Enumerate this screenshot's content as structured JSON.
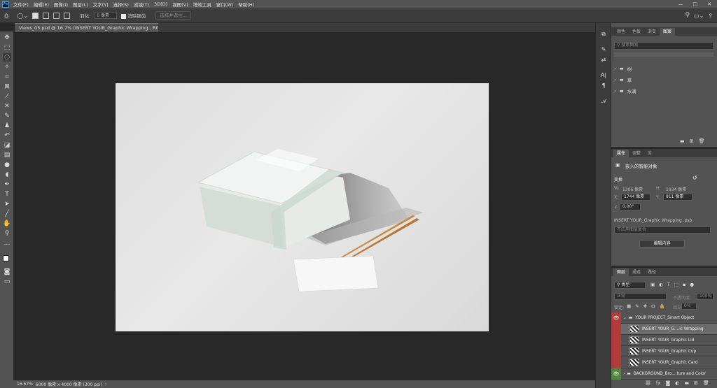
{
  "app": {
    "logo": "Ps"
  },
  "menu": [
    "文件(F)",
    "编辑(E)",
    "图像(I)",
    "图层(L)",
    "文字(Y)",
    "选择(S)",
    "滤镜(T)",
    "3D(D)",
    "视图(V)",
    "增效工具",
    "窗口(W)",
    "帮助(H)"
  ],
  "window_controls": [
    "—",
    "□",
    "✕"
  ],
  "options": {
    "feather_label": "羽化:",
    "feather_value": "0 像素",
    "antialias_label": "消除锯齿",
    "select_subject": "选择并遮住..."
  },
  "document": {
    "tab_title": "Views_05.psd @ 16.7% (INSERT YOUR_Graphic Wrapping , RGB/8)",
    "close": "×"
  },
  "status": {
    "zoom": "16.67%",
    "size": "6000 像素 x 4000 像素 (300 ppi)",
    "arrow": "›"
  },
  "libraries": {
    "tabs": [
      "颜色",
      "色板",
      "渐变",
      "图案"
    ],
    "active_tab": "图案",
    "search_placeholder": "搜索图案",
    "folders": [
      "树",
      "草",
      "水滴"
    ]
  },
  "properties": {
    "tabs": [
      "属性",
      "调整",
      "库"
    ],
    "active_tab": "属性",
    "type_label": "嵌入的智能对象",
    "section": "变换",
    "w_label": "W:",
    "w_value": "1306 像素",
    "h_label": "H:",
    "h_value": "1934 像素",
    "x_label": "X:",
    "x_value": "1744 像素",
    "y_label": "Y:",
    "y_value": "811 像素",
    "angle_value": "0.00°",
    "file_name": "INSERT YOUR_Graphic Wrapping .psb",
    "comp_placeholder": "不应用图层复合",
    "edit_button": "编辑内容"
  },
  "layers": {
    "tabs": [
      "图层",
      "通道",
      "路径"
    ],
    "active_tab": "图层",
    "kind_label": "类型",
    "blend_mode": "正常",
    "opacity_label": "不透明度:",
    "opacity_value": "100%",
    "lock_label": "锁定:",
    "fill_label": "填充:",
    "fill_value": "0%",
    "items": [
      {
        "name": "YOUR PROJECT_Smart Object",
        "type": "group",
        "color": "red"
      },
      {
        "name": "INSERT YOUR_G....ic Wrapping",
        "type": "smart",
        "color": "red",
        "selected": true
      },
      {
        "name": "INSERT YOUR_Graphic Lid",
        "type": "smart",
        "color": "red"
      },
      {
        "name": "INSERT YOUR_Graphic Cup",
        "type": "smart",
        "color": "red"
      },
      {
        "name": "INSERT YOUR_Graphic Card",
        "type": "smart",
        "color": "red"
      },
      {
        "name": "BACKGROUND_Bro....ture and Color",
        "type": "group",
        "color": "green"
      }
    ]
  }
}
